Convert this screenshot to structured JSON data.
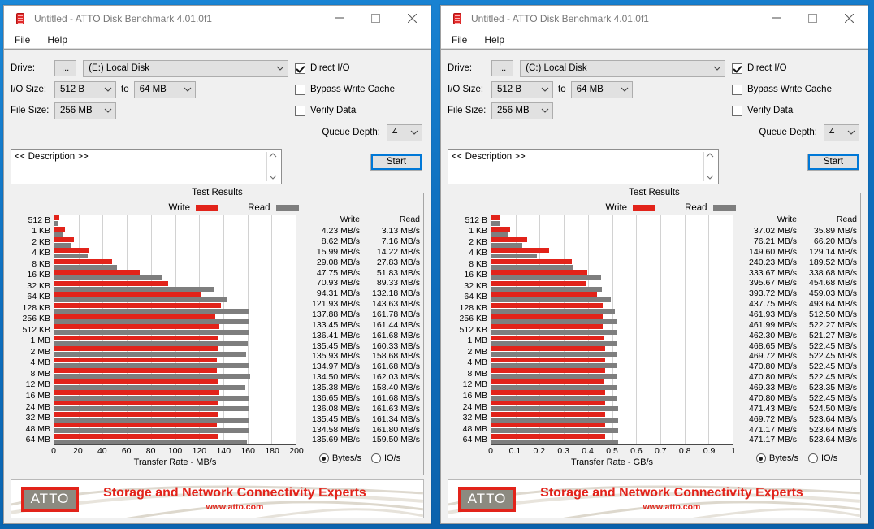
{
  "windows": [
    {
      "title": "Untitled - ATTO Disk Benchmark 4.01.0f1",
      "menu": [
        "File",
        "Help"
      ],
      "labels": {
        "drive": "Drive:",
        "io_size": "I/O Size:",
        "file_size": "File Size:",
        "to": "to",
        "browse": "...",
        "queue_depth": "Queue Depth:",
        "start": "Start",
        "direct_io": "Direct I/O",
        "bypass_write_cache": "Bypass Write Cache",
        "verify_data": "Verify Data",
        "description_placeholder": "<< Description >>",
        "results_group": "Test Results",
        "write": "Write",
        "read": "Read",
        "col_write": "Write",
        "col_read": "Read",
        "bytes_per_s": "Bytes/s",
        "io_per_s": "IO/s"
      },
      "values": {
        "drive": "(E:) Local Disk",
        "io_min": "512 B",
        "io_max": "64 MB",
        "file_size": "256 MB",
        "queue_depth": "4",
        "description": "<< Description >>"
      },
      "checks": {
        "direct_io": true,
        "bypass_write_cache": false,
        "verify_data": false
      },
      "units_selected": "Bytes/s",
      "banner": {
        "logo": "ATTO",
        "tagline": "Storage and Network Connectivity Experts",
        "url": "www.atto.com"
      },
      "chart_data": {
        "type": "bar",
        "title": "Test Results",
        "xlabel": "Transfer Rate - MB/s",
        "ylabel": "",
        "xlim": [
          0,
          200
        ],
        "xticks": [
          0,
          20,
          40,
          60,
          80,
          100,
          120,
          140,
          160,
          180,
          200
        ],
        "xtick_labels": [
          "0",
          "20",
          "40",
          "60",
          "80",
          "100",
          "120",
          "140",
          "160",
          "180",
          "200"
        ],
        "grid": true,
        "legend": [
          "Write",
          "Read"
        ],
        "legend_position": "top-center",
        "categories": [
          "512 B",
          "1 KB",
          "2 KB",
          "4 KB",
          "8 KB",
          "16 KB",
          "32 KB",
          "64 KB",
          "128 KB",
          "256 KB",
          "512 KB",
          "1 MB",
          "2 MB",
          "4 MB",
          "8 MB",
          "12 MB",
          "16 MB",
          "24 MB",
          "32 MB",
          "48 MB",
          "64 MB"
        ],
        "series": [
          {
            "name": "Write",
            "color": "#e2231a",
            "values": [
              4.23,
              8.62,
              15.99,
              29.08,
              47.75,
              70.93,
              94.31,
              121.93,
              137.88,
              133.45,
              136.41,
              135.45,
              135.93,
              134.97,
              134.5,
              135.38,
              136.65,
              136.08,
              135.45,
              134.58,
              135.69
            ],
            "labels": [
              "4.23 MB/s",
              "8.62 MB/s",
              "15.99 MB/s",
              "29.08 MB/s",
              "47.75 MB/s",
              "70.93 MB/s",
              "94.31 MB/s",
              "121.93 MB/s",
              "137.88 MB/s",
              "133.45 MB/s",
              "136.41 MB/s",
              "135.45 MB/s",
              "135.93 MB/s",
              "134.97 MB/s",
              "134.50 MB/s",
              "135.38 MB/s",
              "136.65 MB/s",
              "136.08 MB/s",
              "135.45 MB/s",
              "134.58 MB/s",
              "135.69 MB/s"
            ]
          },
          {
            "name": "Read",
            "color": "#7e7e7e",
            "values": [
              3.13,
              7.16,
              14.22,
              27.83,
              51.83,
              89.33,
              132.18,
              143.63,
              161.78,
              161.44,
              161.68,
              160.33,
              158.68,
              161.68,
              162.03,
              158.4,
              161.68,
              161.63,
              161.34,
              161.8,
              159.5
            ],
            "labels": [
              "3.13 MB/s",
              "7.16 MB/s",
              "14.22 MB/s",
              "27.83 MB/s",
              "51.83 MB/s",
              "89.33 MB/s",
              "132.18 MB/s",
              "143.63 MB/s",
              "161.78 MB/s",
              "161.44 MB/s",
              "161.68 MB/s",
              "160.33 MB/s",
              "158.68 MB/s",
              "161.68 MB/s",
              "162.03 MB/s",
              "158.40 MB/s",
              "161.68 MB/s",
              "161.63 MB/s",
              "161.34 MB/s",
              "161.80 MB/s",
              "159.50 MB/s"
            ]
          }
        ]
      }
    },
    {
      "title": "Untitled - ATTO Disk Benchmark 4.01.0f1",
      "menu": [
        "File",
        "Help"
      ],
      "labels": {
        "drive": "Drive:",
        "io_size": "I/O Size:",
        "file_size": "File Size:",
        "to": "to",
        "browse": "...",
        "queue_depth": "Queue Depth:",
        "start": "Start",
        "direct_io": "Direct I/O",
        "bypass_write_cache": "Bypass Write Cache",
        "verify_data": "Verify Data",
        "description_placeholder": "<< Description >>",
        "results_group": "Test Results",
        "write": "Write",
        "read": "Read",
        "col_write": "Write",
        "col_read": "Read",
        "bytes_per_s": "Bytes/s",
        "io_per_s": "IO/s"
      },
      "values": {
        "drive": "(C:) Local Disk",
        "io_min": "512 B",
        "io_max": "64 MB",
        "file_size": "256 MB",
        "queue_depth": "4",
        "description": "<< Description >>"
      },
      "checks": {
        "direct_io": true,
        "bypass_write_cache": false,
        "verify_data": false
      },
      "units_selected": "Bytes/s",
      "banner": {
        "logo": "ATTO",
        "tagline": "Storage and Network Connectivity Experts",
        "url": "www.atto.com"
      },
      "chart_data": {
        "type": "bar",
        "title": "Test Results",
        "xlabel": "Transfer Rate - GB/s",
        "ylabel": "",
        "xlim": [
          0,
          1
        ],
        "xticks": [
          0,
          0.1,
          0.2,
          0.3,
          0.4,
          0.5,
          0.6,
          0.7,
          0.8,
          0.9,
          1
        ],
        "xtick_labels": [
          "0",
          "0.1",
          "0.2",
          "0.3",
          "0.4",
          "0.5",
          "0.6",
          "0.7",
          "0.8",
          "0.9",
          "1"
        ],
        "grid": true,
        "legend": [
          "Write",
          "Read"
        ],
        "legend_position": "top-center",
        "categories": [
          "512 B",
          "1 KB",
          "2 KB",
          "4 KB",
          "8 KB",
          "16 KB",
          "32 KB",
          "64 KB",
          "128 KB",
          "256 KB",
          "512 KB",
          "1 MB",
          "2 MB",
          "4 MB",
          "8 MB",
          "12 MB",
          "16 MB",
          "24 MB",
          "32 MB",
          "48 MB",
          "64 MB"
        ],
        "series": [
          {
            "name": "Write",
            "color": "#e2231a",
            "values": [
              0.03702,
              0.07621,
              0.1496,
              0.24023,
              0.33367,
              0.39567,
              0.39372,
              0.43775,
              0.46193,
              0.46199,
              0.4623,
              0.46865,
              0.46972,
              0.4708,
              0.4708,
              0.46933,
              0.4708,
              0.47143,
              0.46972,
              0.47117,
              0.47117
            ],
            "labels": [
              "37.02 MB/s",
              "76.21 MB/s",
              "149.60 MB/s",
              "240.23 MB/s",
              "333.67 MB/s",
              "395.67 MB/s",
              "393.72 MB/s",
              "437.75 MB/s",
              "461.93 MB/s",
              "461.99 MB/s",
              "462.30 MB/s",
              "468.65 MB/s",
              "469.72 MB/s",
              "470.80 MB/s",
              "470.80 MB/s",
              "469.33 MB/s",
              "470.80 MB/s",
              "471.43 MB/s",
              "469.72 MB/s",
              "471.17 MB/s",
              "471.17 MB/s"
            ]
          },
          {
            "name": "Read",
            "color": "#7e7e7e",
            "values": [
              0.03589,
              0.0662,
              0.12914,
              0.18952,
              0.33868,
              0.45468,
              0.45903,
              0.49364,
              0.5125,
              0.52227,
              0.52127,
              0.52245,
              0.52245,
              0.52245,
              0.52245,
              0.52335,
              0.52245,
              0.5245,
              0.52364,
              0.52364,
              0.52364
            ],
            "labels": [
              "35.89 MB/s",
              "66.20 MB/s",
              "129.14 MB/s",
              "189.52 MB/s",
              "338.68 MB/s",
              "454.68 MB/s",
              "459.03 MB/s",
              "493.64 MB/s",
              "512.50 MB/s",
              "522.27 MB/s",
              "521.27 MB/s",
              "522.45 MB/s",
              "522.45 MB/s",
              "522.45 MB/s",
              "522.45 MB/s",
              "523.35 MB/s",
              "522.45 MB/s",
              "524.50 MB/s",
              "523.64 MB/s",
              "523.64 MB/s",
              "523.64 MB/s"
            ]
          }
        ]
      }
    }
  ],
  "theme": {
    "accent": "#0078d7",
    "write_color": "#e2231a",
    "read_color": "#7e7e7e",
    "desktop": "#0f6fbe"
  }
}
